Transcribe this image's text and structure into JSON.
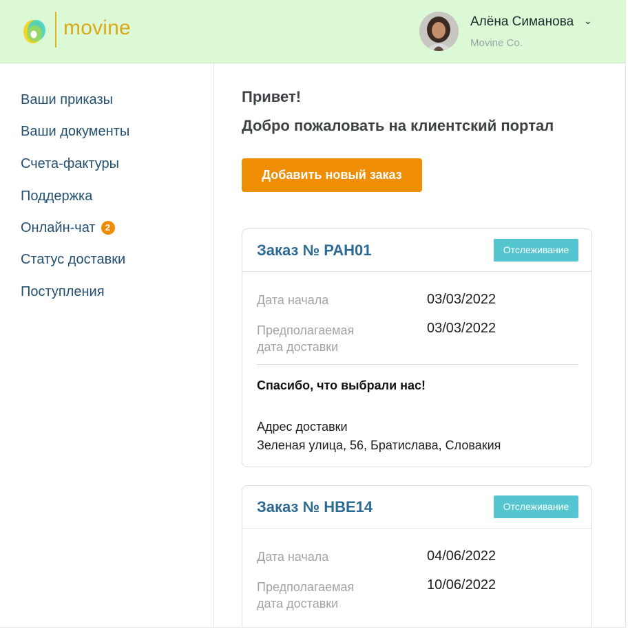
{
  "brand": {
    "name": "movine",
    "logo_icon": "movine-drop-logo"
  },
  "user": {
    "name": "Алёна Симанова",
    "company": "Movine Co.",
    "chevron_icon": "chevron-down-icon"
  },
  "sidebar": {
    "items": [
      {
        "label": "Ваши приказы"
      },
      {
        "label": "Ваши документы"
      },
      {
        "label": "Счета-фактуры"
      },
      {
        "label": "Поддержка"
      },
      {
        "label": "Онлайн-чат",
        "badge": "2"
      },
      {
        "label": "Статус доставки"
      },
      {
        "label": "Поступления"
      }
    ]
  },
  "main": {
    "greeting": "Привет!",
    "welcome": "Добро пожаловать на клиентский портал",
    "add_button": "Добавить новый заказ"
  },
  "orders": [
    {
      "title": "Заказ № PAH01",
      "track_label": "Отслеживание",
      "start_label": "Дата начала",
      "start_date": "03/03/2022",
      "eta_label_line1": "Предполагаемая",
      "eta_label_line2": "дата доставки",
      "eta_date": "03/03/2022",
      "thanks": "Спасибо, что выбрали нас!",
      "address_label": "Адрес доставки",
      "address": "Зеленая улица, 56, Братислава, Словакия"
    },
    {
      "title": "Заказ № HBE14",
      "track_label": "Отслеживание",
      "start_label": "Дата начала",
      "start_date": "04/06/2022",
      "eta_label_line1": "Предполагаемая",
      "eta_label_line2": "дата доставки",
      "eta_date": "10/06/2022"
    }
  ],
  "colors": {
    "header_bg": "#dcf9d5",
    "brand_gold": "#d9a91a",
    "nav_text": "#234f70",
    "accent_orange": "#ef8d05",
    "order_title": "#2d6a93",
    "track_button": "#55c6d0"
  }
}
